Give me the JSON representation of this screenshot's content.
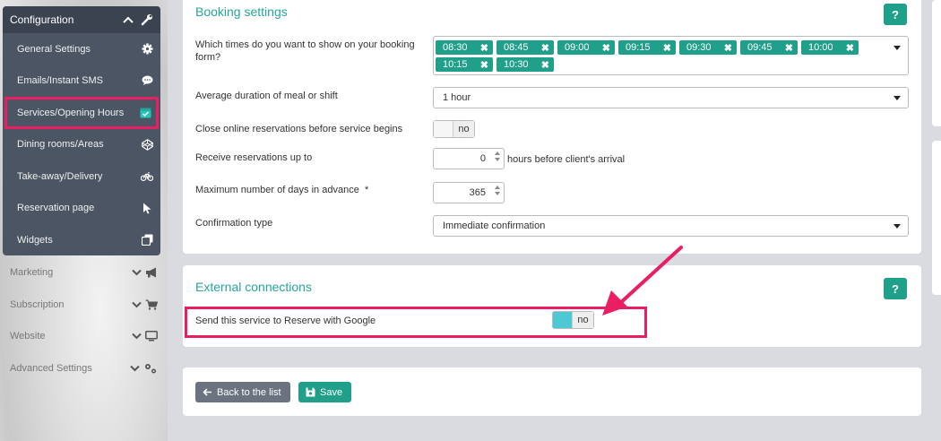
{
  "sidebar": {
    "config_title": "Configuration",
    "items": [
      {
        "label": "General Settings",
        "icon": "gear-icon"
      },
      {
        "label": "Emails/Instant SMS",
        "icon": "chat-bubble-icon"
      },
      {
        "label": "Services/Opening Hours",
        "icon": "calendar-check-icon"
      },
      {
        "label": "Dining rooms/Areas",
        "icon": "codepen-icon"
      },
      {
        "label": "Take-away/Delivery",
        "icon": "bicycle-icon"
      },
      {
        "label": "Reservation page",
        "icon": "pointer-icon"
      },
      {
        "label": "Widgets",
        "icon": "clone-icon"
      }
    ],
    "sections": [
      {
        "label": "Marketing",
        "icon": "megaphone-icon"
      },
      {
        "label": "Subscription",
        "icon": "cart-icon"
      },
      {
        "label": "Website",
        "icon": "monitor-icon"
      },
      {
        "label": "Advanced Settings",
        "icon": "gears-icon"
      }
    ]
  },
  "booking": {
    "title": "Booking settings",
    "help": "?",
    "times_label": "Which times do you want to show on your booking form?",
    "times": [
      "08:30",
      "08:45",
      "09:00",
      "09:15",
      "09:30",
      "09:45",
      "10:00",
      "10:15",
      "10:30"
    ],
    "tag_remove": "✖",
    "duration_label": "Average duration of meal or shift",
    "duration_value": "1 hour",
    "close_label": "Close online reservations before service begins",
    "close_value": "no",
    "receive_label": "Receive reservations up to",
    "receive_value": "0",
    "receive_suffix": "hours before client's arrival",
    "max_days_label": "Maximum number of days in advance",
    "max_days_required": "*",
    "max_days_value": "365",
    "confirm_label": "Confirmation type",
    "confirm_value": "Immediate confirmation"
  },
  "external": {
    "title": "External connections",
    "help": "?",
    "google_label": "Send this service to Reserve with Google",
    "google_value": "no"
  },
  "actions": {
    "back_label": "Back to the list",
    "save_label": "Save"
  },
  "colors": {
    "accent": "#20a08a",
    "highlight": "#e91e63",
    "sidebar_bg": "#4b5563"
  }
}
